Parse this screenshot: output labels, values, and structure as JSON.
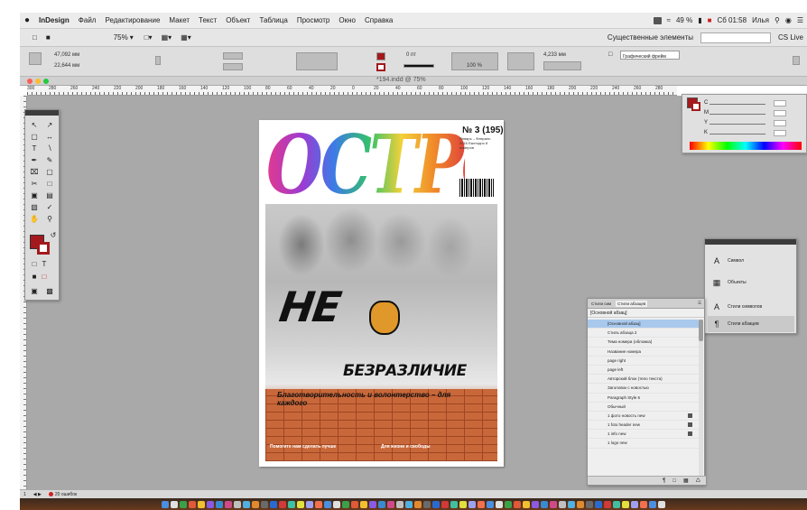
{
  "menubar": {
    "apple": "",
    "items": [
      "InDesign",
      "Файл",
      "Редактирование",
      "Макет",
      "Текст",
      "Объект",
      "Таблица",
      "Просмотр",
      "Окно",
      "Справка"
    ],
    "battery": "49 %",
    "clock": "Сб 01:58",
    "user": "Илья"
  },
  "apptop": {
    "zoom": "75%",
    "workspace": "Существенные элементы",
    "cclive": "CS Live"
  },
  "control": {
    "x_field": "47,092 мм",
    "y_field": "22,644 мм",
    "stroke_weight": "0 пт",
    "stroke_measure": "4,233 мм",
    "percent": "100 %",
    "graphic_frame": "Графический фрейм"
  },
  "document_tab": {
    "title": "*194.indd @ 75%",
    "colors": [
      "#fc5f57",
      "#fdbc2e",
      "#28c840"
    ]
  },
  "ruler": {
    "labels": [
      "300",
      "280",
      "260",
      "240",
      "220",
      "200",
      "180",
      "160",
      "140",
      "120",
      "100",
      "80",
      "60",
      "40",
      "20",
      "0",
      "20",
      "40",
      "60",
      "80",
      "100",
      "120",
      "140",
      "160",
      "180",
      "200",
      "220",
      "240",
      "260",
      "280",
      "300",
      "320",
      "340",
      "360",
      "380",
      "400"
    ]
  },
  "cover": {
    "title": "ОСТРОВ",
    "issue": "№ 3 (195)",
    "issue_info": "Январь – Февраль 2016 Ежегодно 8 номеров",
    "headline_ne": "НЕ",
    "headline_bez": "БЕЗРАЗЛИЧИЕ",
    "subheadline": "Благотворительность и волонтерство – для каждого",
    "foot_left": "Помогите нам сделать лучше",
    "foot_right": "Для жизни и свободы"
  },
  "color_panel": {
    "fill": "#a3191e",
    "labels": [
      "C",
      "M",
      "Y",
      "K"
    ]
  },
  "styles_panel": {
    "items": [
      "Символ",
      "Объекты",
      "Стили символов",
      "Стили абзацев"
    ]
  },
  "para_panel": {
    "tabs": [
      "Стили сим",
      "Стили абзацев"
    ],
    "current": "[Основной абзац]",
    "items": [
      "[Основной абзац]",
      "Стиль абзаца 2",
      "Тема номера (обложка)",
      "Название номера",
      "page right",
      "page left",
      "Авторский блок (тело текста)",
      "Заголовок с новостью",
      "Paragraph Style 6",
      "Обычный",
      "1 фото новость new",
      "1 foto header new",
      "1 info new",
      "1 logo new"
    ]
  },
  "statusbar": {
    "page": "1",
    "errors": "20 ошибок"
  }
}
